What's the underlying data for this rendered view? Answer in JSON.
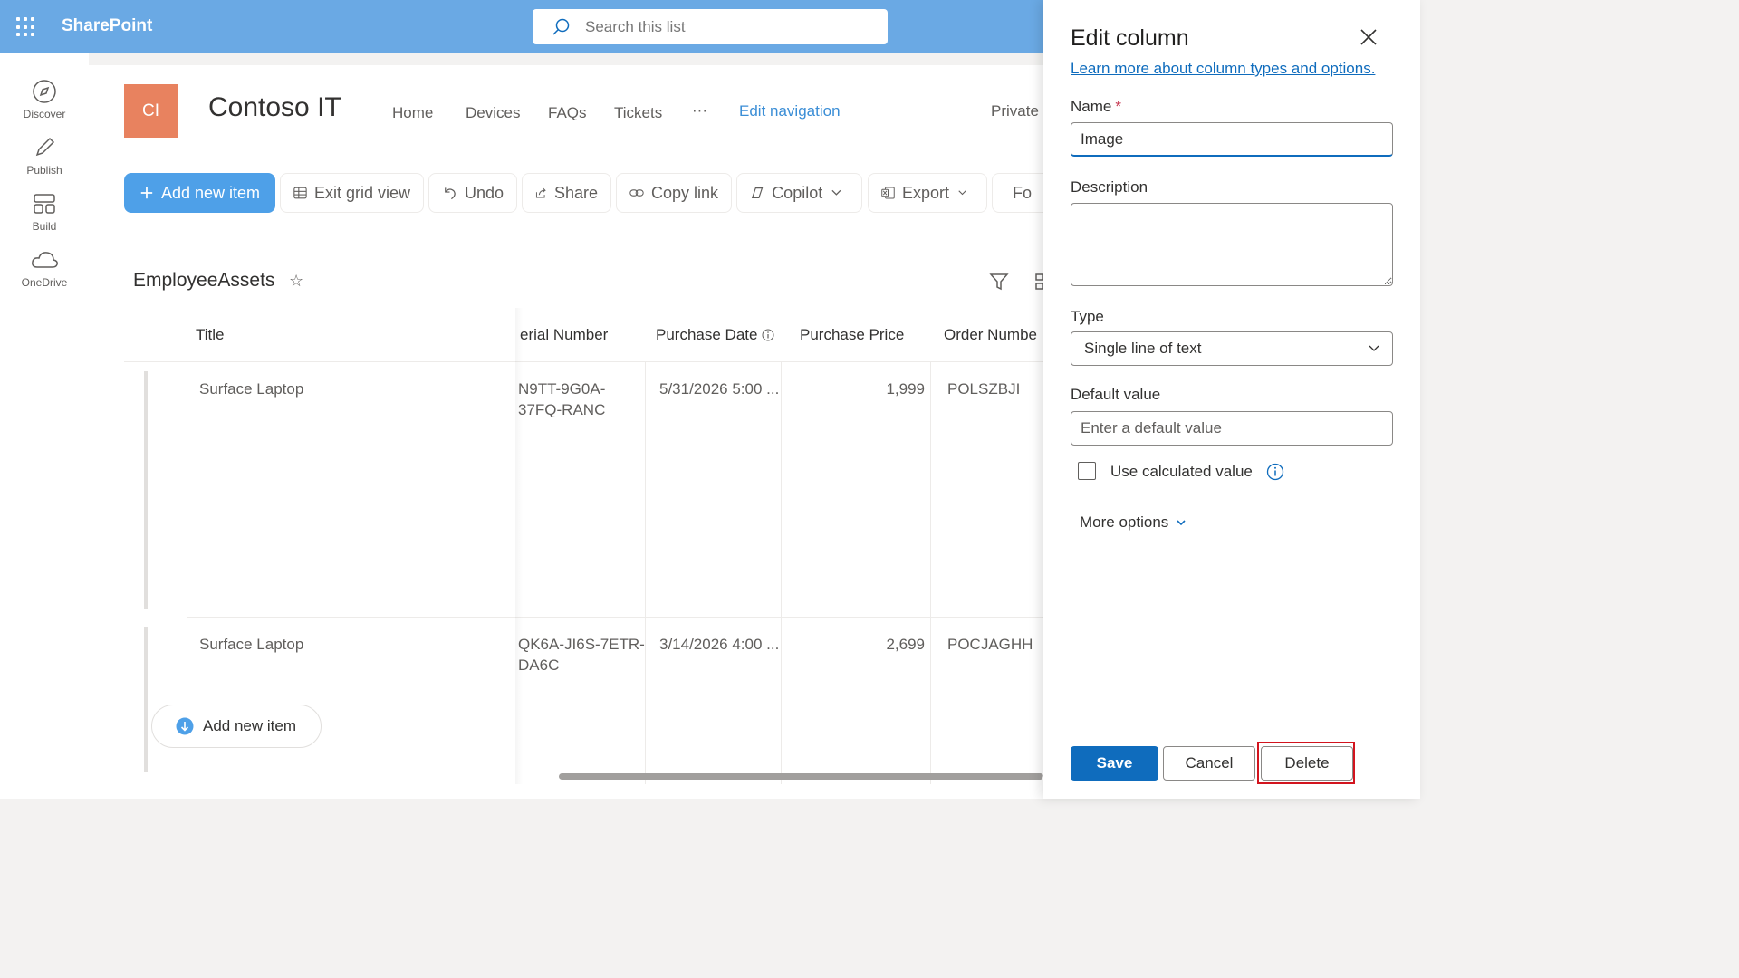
{
  "suite": {
    "brand": "SharePoint",
    "search_placeholder": "Search this list"
  },
  "rail": [
    {
      "label": "Discover",
      "icon": "compass-icon"
    },
    {
      "label": "Publish",
      "icon": "pencil-icon"
    },
    {
      "label": "Build",
      "icon": "layout-icon"
    },
    {
      "label": "OneDrive",
      "icon": "cloud-icon"
    }
  ],
  "site": {
    "logo_text": "CI",
    "title": "Contoso IT",
    "nav": [
      "Home",
      "Devices",
      "FAQs",
      "Tickets",
      "···"
    ],
    "edit_nav": "Edit navigation",
    "privacy": "Private"
  },
  "commands": {
    "add": "Add new item",
    "exit_grid": "Exit grid view",
    "undo": "Undo",
    "share": "Share",
    "copy_link": "Copy link",
    "copilot": "Copilot",
    "export": "Export",
    "forms": "Fo"
  },
  "list": {
    "title": "EmployeeAssets",
    "columns": [
      "Title",
      "erial Number",
      "Purchase Date",
      "Purchase Price",
      "Order Numbe"
    ],
    "rows": [
      {
        "title": "Surface Laptop",
        "serial1": "N9TT-9G0A-",
        "serial2": "37FQ-RANC",
        "date": "5/31/2026 5:00 ...",
        "price": "1,999",
        "order": "POLSZBJI"
      },
      {
        "title": "Surface Laptop",
        "serial1": "QK6A-JI6S-7ETR-",
        "serial2": "DA6C",
        "date": "3/14/2026 4:00 ...",
        "price": "2,699",
        "order": "POCJAGHH"
      }
    ],
    "add_row": "Add new item"
  },
  "panel": {
    "title": "Edit column",
    "learn_more": "Learn more about column types and options.",
    "name_label": "Name",
    "required_mark": "*",
    "name_value": "Image",
    "description_label": "Description",
    "type_label": "Type",
    "type_value": "Single line of text",
    "default_label": "Default value",
    "default_placeholder": "Enter a default value",
    "calc_label": "Use calculated value",
    "more_options": "More options",
    "save": "Save",
    "cancel": "Cancel",
    "delete": "Delete"
  },
  "colors": {
    "suite": "#6aa9e4",
    "primary": "#0f6cbd",
    "logo": "#e8825f",
    "highlight": "#d2141e"
  }
}
